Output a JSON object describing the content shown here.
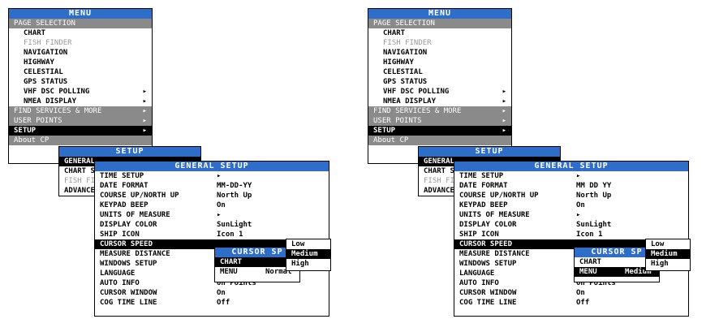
{
  "panels": [
    {
      "main_menu": {
        "title": "MENU",
        "items": [
          {
            "label": "PAGE SELECTION",
            "style": "grey",
            "arrow": ""
          },
          {
            "label": "CHART",
            "style": "normal",
            "arrow": ""
          },
          {
            "label": "FISH FINDER",
            "style": "dim",
            "arrow": ""
          },
          {
            "label": "NAVIGATION",
            "style": "normal",
            "arrow": ""
          },
          {
            "label": "HIGHWAY",
            "style": "normal",
            "arrow": ""
          },
          {
            "label": "CELESTIAL",
            "style": "normal",
            "arrow": ""
          },
          {
            "label": "GPS STATUS",
            "style": "normal",
            "arrow": ""
          },
          {
            "label": "VHF DSC POLLING",
            "style": "normal",
            "arrow": "▸"
          },
          {
            "label": "NMEA DISPLAY",
            "style": "normal",
            "arrow": "▸"
          },
          {
            "label": "FIND SERVICES & MORE",
            "style": "grey",
            "arrow": "▸"
          },
          {
            "label": "USER POINTS",
            "style": "grey",
            "arrow": "▸"
          },
          {
            "label": "SETUP",
            "style": "sel",
            "arrow": "▸"
          },
          {
            "label": "About CP",
            "style": "grey",
            "arrow": ""
          }
        ]
      },
      "setup_menu": {
        "title": "SETUP",
        "items": [
          {
            "label": "GENERAL",
            "style": "sel"
          },
          {
            "label": "CHART S",
            "style": "normal"
          },
          {
            "label": "FISH FI",
            "style": "dim"
          },
          {
            "label": "ADVANCE",
            "style": "normal"
          }
        ]
      },
      "general_menu": {
        "title": "GENERAL SETUP",
        "items": [
          {
            "label": "TIME SETUP",
            "value": "▸",
            "style": "normal"
          },
          {
            "label": "DATE FORMAT",
            "value": "MM-DD-YY",
            "style": "normal"
          },
          {
            "label": "COURSE UP/NORTH UP",
            "value": "North Up",
            "style": "normal"
          },
          {
            "label": "KEYPAD BEEP",
            "value": "On",
            "style": "normal"
          },
          {
            "label": "UNITS OF MEASURE",
            "value": "▸",
            "style": "normal"
          },
          {
            "label": "DISPLAY COLOR",
            "value": "SunLight",
            "style": "normal"
          },
          {
            "label": "SHIP ICON",
            "value": "Icon 1",
            "style": "normal"
          },
          {
            "label": "CURSOR SPEED",
            "value": "",
            "style": "sel"
          },
          {
            "label": "MEASURE DISTANCE",
            "value": "",
            "style": "normal"
          },
          {
            "label": "WINDOWS SETUP",
            "value": "",
            "style": "normal"
          },
          {
            "label": "LANGUAGE",
            "value": "",
            "style": "normal"
          },
          {
            "label": "AUTO INFO",
            "value": "On Points",
            "style": "normal"
          },
          {
            "label": "CURSOR WINDOW",
            "value": "On",
            "style": "normal"
          },
          {
            "label": "COG TIME LINE",
            "value": "Off",
            "style": "normal"
          }
        ]
      },
      "cursor_menu": {
        "title": "CURSOR SP",
        "items": [
          {
            "label": "CHART",
            "value": "",
            "style": "sel"
          },
          {
            "label": "MENU",
            "value": "Normal",
            "style": "normal"
          }
        ]
      },
      "speed_menu": {
        "items": [
          {
            "label": "Low",
            "style": "normal"
          },
          {
            "label": "Medium",
            "style": "sel"
          },
          {
            "label": "High",
            "style": "normal"
          }
        ]
      }
    },
    {
      "main_menu": {
        "title": "MENU",
        "items": [
          {
            "label": "PAGE SELECTION",
            "style": "grey",
            "arrow": ""
          },
          {
            "label": "CHART",
            "style": "normal",
            "arrow": ""
          },
          {
            "label": "FISH FINDER",
            "style": "dim",
            "arrow": ""
          },
          {
            "label": "NAVIGATION",
            "style": "normal",
            "arrow": ""
          },
          {
            "label": "HIGHWAY",
            "style": "normal",
            "arrow": ""
          },
          {
            "label": "CELESTIAL",
            "style": "normal",
            "arrow": ""
          },
          {
            "label": "GPS STATUS",
            "style": "normal",
            "arrow": ""
          },
          {
            "label": "VHF DSC POLLING",
            "style": "normal",
            "arrow": "▸"
          },
          {
            "label": "NMEA DISPLAY",
            "style": "normal",
            "arrow": "▸"
          },
          {
            "label": "FIND SERVICES & MORE",
            "style": "grey",
            "arrow": "▸"
          },
          {
            "label": "USER POINTS",
            "style": "grey",
            "arrow": "▸"
          },
          {
            "label": "SETUP",
            "style": "sel",
            "arrow": "▸"
          },
          {
            "label": "About CP",
            "style": "grey",
            "arrow": ""
          }
        ]
      },
      "setup_menu": {
        "title": "SETUP",
        "items": [
          {
            "label": "GENERAL",
            "style": "sel"
          },
          {
            "label": "CHART S",
            "style": "normal"
          },
          {
            "label": "FISH FI",
            "style": "dim"
          },
          {
            "label": "ADVANCE",
            "style": "normal"
          }
        ]
      },
      "general_menu": {
        "title": "GENERAL SETUP",
        "items": [
          {
            "label": "TIME SETUP",
            "value": "▸",
            "style": "normal"
          },
          {
            "label": "DATE FORMAT",
            "value": "MM DD YY",
            "style": "normal"
          },
          {
            "label": "COURSE UP/NORTH UP",
            "value": "North Up",
            "style": "normal"
          },
          {
            "label": "KEYPAD BEEP",
            "value": "On",
            "style": "normal"
          },
          {
            "label": "UNITS OF MEASURE",
            "value": "▸",
            "style": "normal"
          },
          {
            "label": "DISPLAY COLOR",
            "value": "SunLight",
            "style": "normal"
          },
          {
            "label": "SHIP ICON",
            "value": "Icon 1",
            "style": "normal"
          },
          {
            "label": "CURSOR SPEED",
            "value": "",
            "style": "sel"
          },
          {
            "label": "MEASURE DISTANCE",
            "value": "",
            "style": "normal"
          },
          {
            "label": "WINDOWS SETUP",
            "value": "",
            "style": "normal"
          },
          {
            "label": "LANGUAGE",
            "value": "",
            "style": "normal"
          },
          {
            "label": "AUTO INFO",
            "value": "On Points",
            "style": "normal"
          },
          {
            "label": "CURSOR WINDOW",
            "value": "On",
            "style": "normal"
          },
          {
            "label": "COG TIME LINE",
            "value": "Off",
            "style": "normal"
          }
        ]
      },
      "cursor_menu": {
        "title": "CURSOR SP",
        "items": [
          {
            "label": "CHART",
            "value": "",
            "style": "normal"
          },
          {
            "label": "MENU",
            "value": "Medium",
            "style": "sel"
          }
        ]
      },
      "speed_menu": {
        "items": [
          {
            "label": "Low",
            "style": "normal"
          },
          {
            "label": "Medium",
            "style": "sel"
          },
          {
            "label": "High",
            "style": "normal"
          }
        ]
      }
    }
  ]
}
